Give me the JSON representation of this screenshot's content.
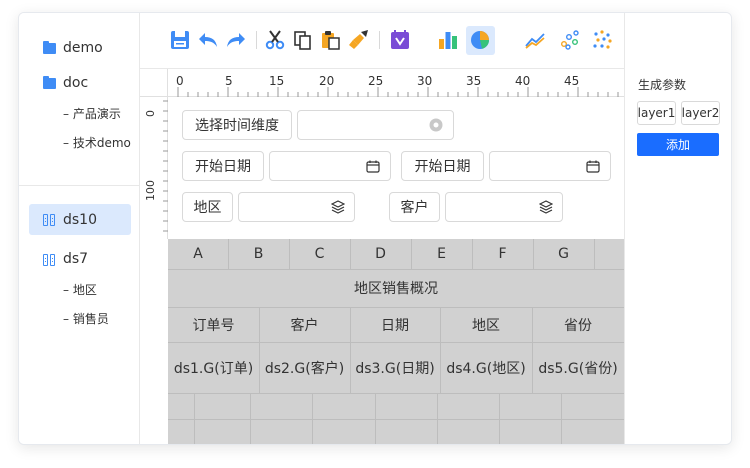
{
  "sidebar": {
    "top_items": [
      {
        "label": "demo",
        "icon": "folder-icon"
      },
      {
        "label": "doc",
        "icon": "folder-icon",
        "children": [
          "产品演示",
          "技术demo"
        ]
      }
    ],
    "datasets": [
      {
        "label": "ds10",
        "icon": "dataset-icon",
        "selected": true
      },
      {
        "label": "ds7",
        "icon": "dataset-icon",
        "children": [
          "地区",
          "销售员"
        ]
      }
    ],
    "child_prefix": "–"
  },
  "toolbar": {
    "icons": [
      "save-icon",
      "undo-icon",
      "redo-icon",
      "cut-icon",
      "copy-icon",
      "paste-icon",
      "format-brush-icon",
      "preview-icon",
      "bar-chart-icon",
      "pie-chart-icon",
      "line-chart-icon",
      "scatter-chart-icon",
      "dot-matrix-icon"
    ],
    "active": "pie-chart-icon"
  },
  "ruler": {
    "top_labels": [
      "0",
      "5",
      "15",
      "20",
      "25",
      "30",
      "35",
      "40",
      "45"
    ],
    "left_labels": [
      "0",
      "100"
    ]
  },
  "form": {
    "time_dimension_label": "选择时间维度",
    "start_date_label_1": "开始日期",
    "start_date_label_2": "开始日期",
    "region_label": "地区",
    "customer_label": "客户"
  },
  "grid": {
    "columns": [
      "A",
      "B",
      "C",
      "D",
      "E",
      "F",
      "G"
    ],
    "title": "地区销售概况",
    "headers": [
      "订单号",
      "客户",
      "日期",
      "地区",
      "省份"
    ],
    "fields": [
      "ds1.G(订单)",
      "ds2.G(客户)",
      "ds3.G(日期)",
      "ds4.G(地区)",
      "ds5.G(省份)"
    ]
  },
  "right_panel": {
    "title": "生成参数",
    "layers": [
      "layer1",
      "layer2"
    ],
    "add_button": "添加"
  },
  "colors": {
    "accent": "#1a6dff",
    "icon_blue": "#3f8cf5",
    "selection": "#dbe9fd",
    "grid_bg": "#d1d1d1"
  }
}
